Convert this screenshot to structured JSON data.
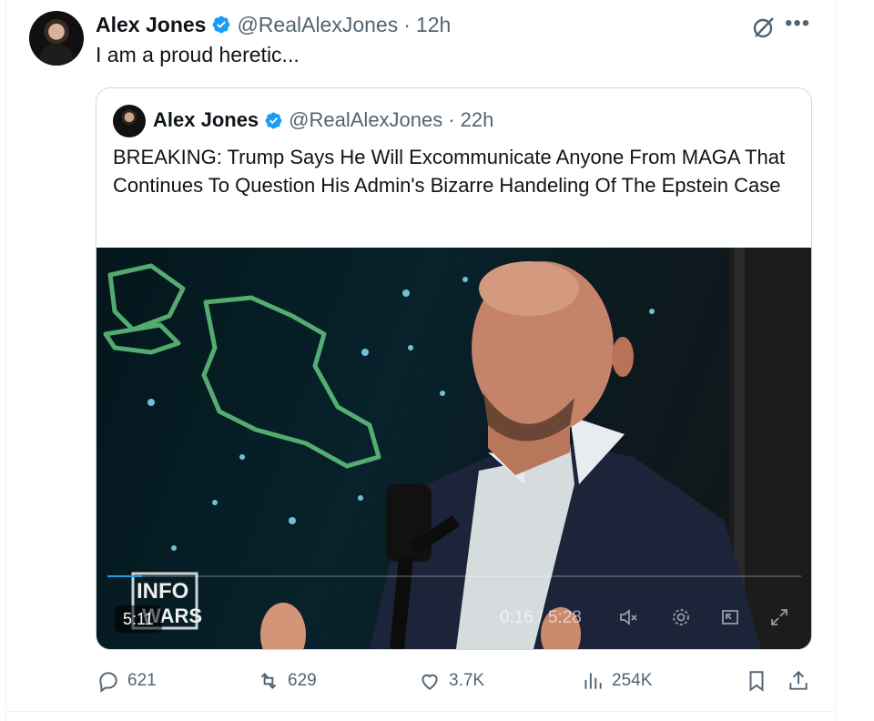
{
  "tweet": {
    "author_name": "Alex Jones",
    "handle": "@RealAlexJones",
    "time": "12h",
    "separator": "·",
    "text": "I am a proud heretic..."
  },
  "quoted": {
    "author_name": "Alex Jones",
    "handle": "@RealAlexJones",
    "time": "22h",
    "separator": "·",
    "text": "BREAKING: Trump Says He Will Excommunicate Anyone From MAGA That Continues To Question His Admin's Bizarre Handeling Of The Epstein Case",
    "video": {
      "duration": "5:11",
      "timecode": "0:16 / 5:28",
      "watermark": "INFO WARS",
      "progress_fraction": 0.05
    }
  },
  "actions": {
    "replies": "621",
    "reposts": "629",
    "likes": "3.7K",
    "views": "254K"
  },
  "colors": {
    "verified_blue": "#1d9bf0",
    "secondary_text": "#536471",
    "border": "#cfd9de"
  },
  "icons": [
    "verified-icon",
    "grok-icon",
    "more-icon",
    "reply-icon",
    "repost-icon",
    "like-icon",
    "views-icon",
    "bookmark-icon",
    "share-icon",
    "mute-icon",
    "settings-icon",
    "pip-icon",
    "fullscreen-icon"
  ]
}
